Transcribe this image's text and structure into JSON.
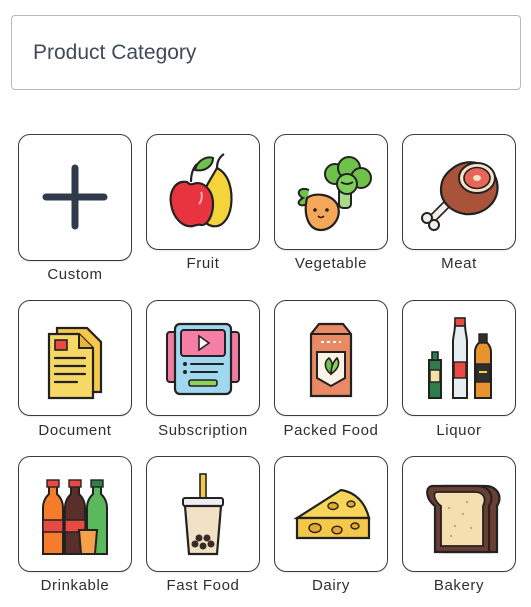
{
  "header": {
    "placeholder": "Product Category"
  },
  "categories": [
    {
      "label": "Custom",
      "icon": "plus-icon"
    },
    {
      "label": "Fruit",
      "icon": "fruit-icon"
    },
    {
      "label": "Vegetable",
      "icon": "vegetable-icon"
    },
    {
      "label": "Meat",
      "icon": "meat-icon"
    },
    {
      "label": "Document",
      "icon": "document-icon"
    },
    {
      "label": "Subscription",
      "icon": "subscription-icon"
    },
    {
      "label": "Packed Food",
      "icon": "packed-food-icon"
    },
    {
      "label": "Liquor",
      "icon": "liquor-icon"
    },
    {
      "label": "Drinkable",
      "icon": "drinkable-icon"
    },
    {
      "label": "Fast Food",
      "icon": "fast-food-icon"
    },
    {
      "label": "Dairy",
      "icon": "dairy-icon"
    },
    {
      "label": "Bakery",
      "icon": "bakery-icon"
    }
  ]
}
